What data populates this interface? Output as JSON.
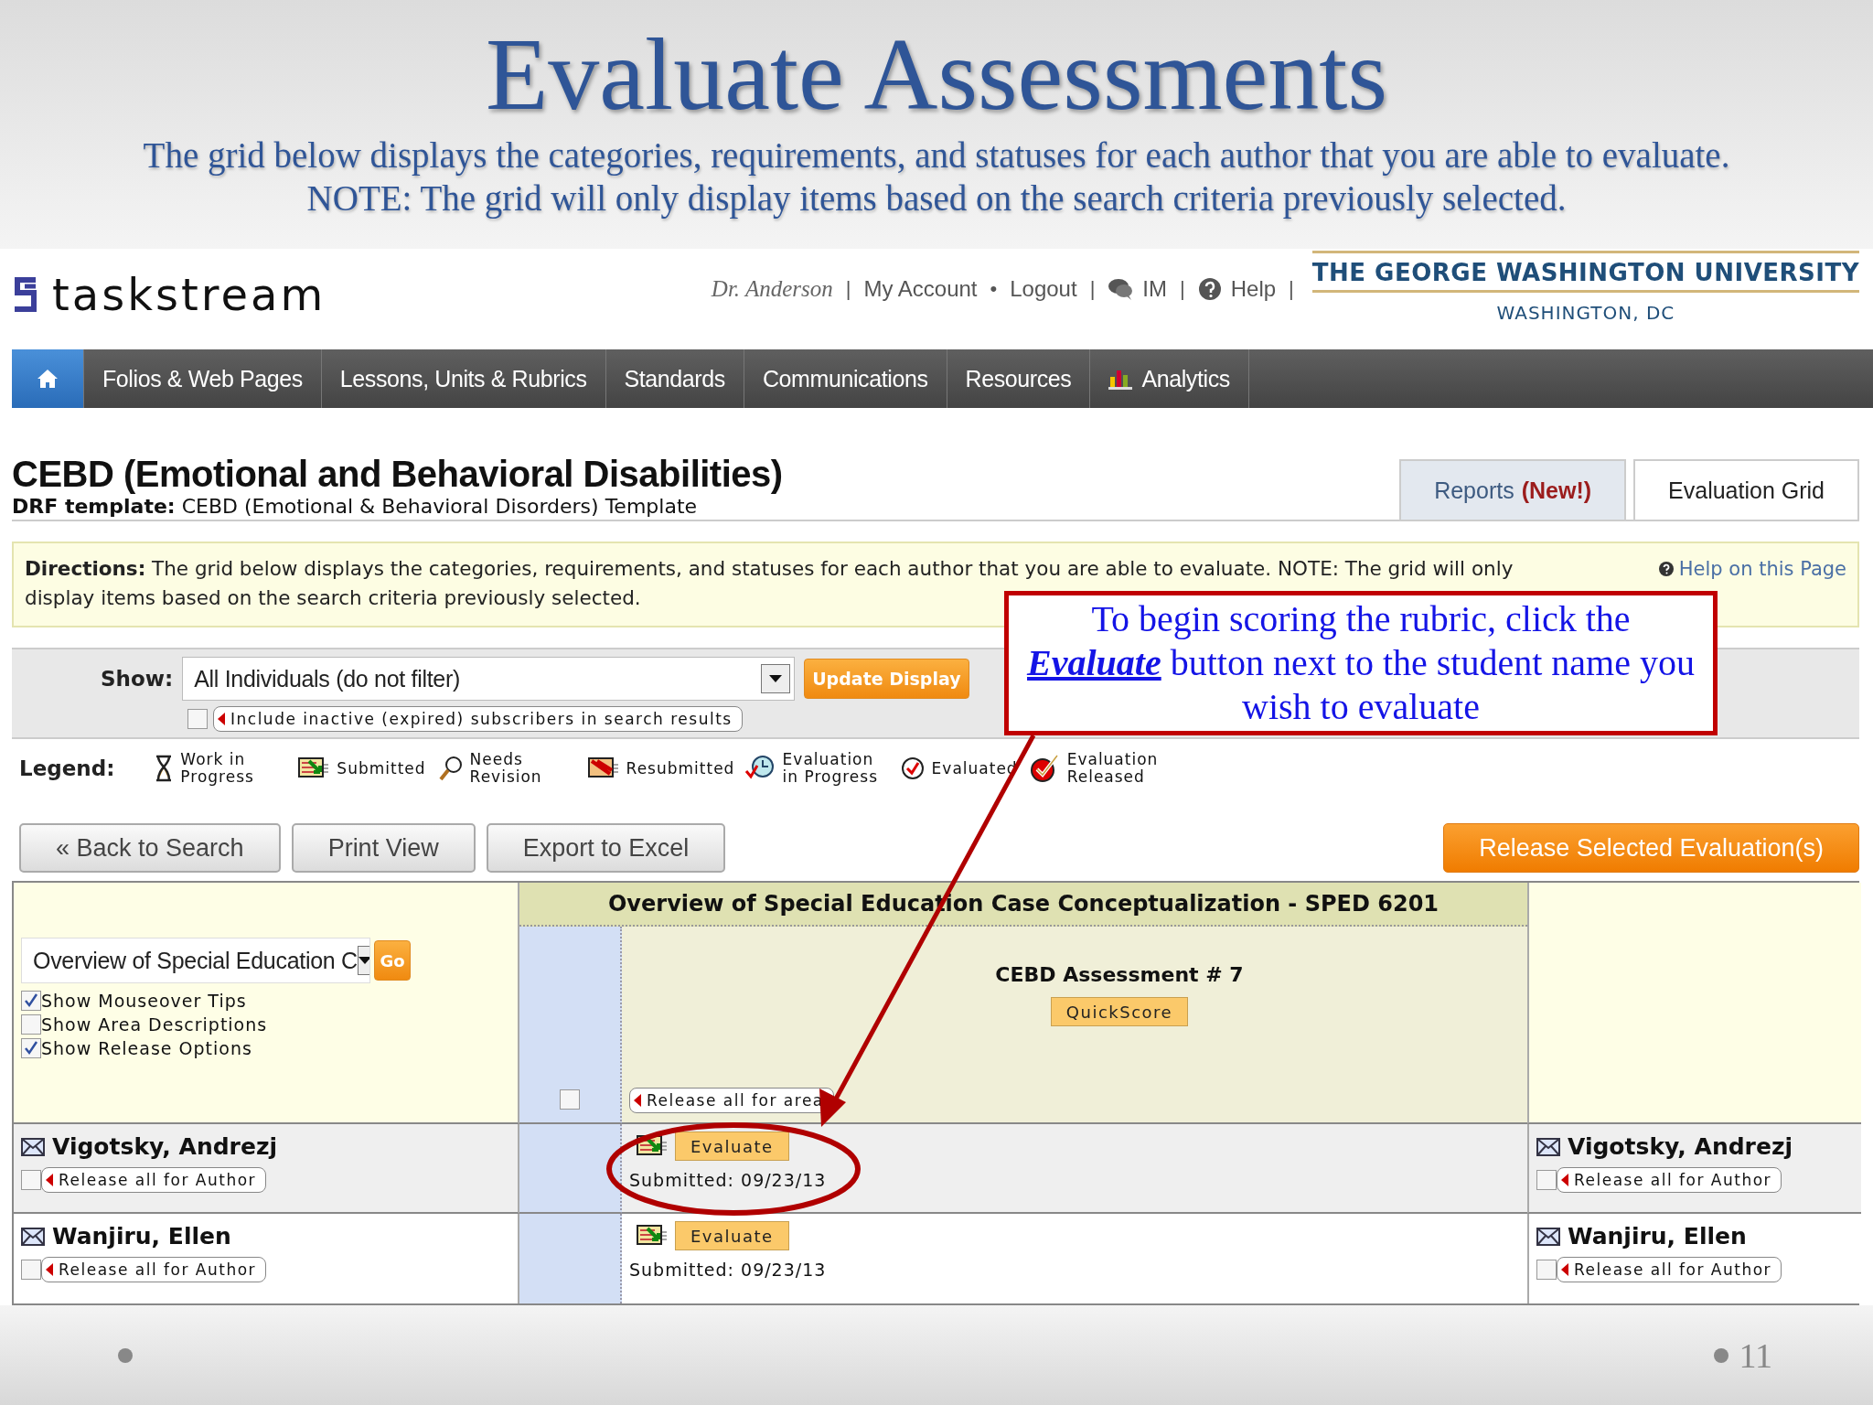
{
  "slide": {
    "title": "Evaluate Assessments",
    "subtitle": "The grid below displays the categories, requirements, and statuses for each author that you are able to evaluate. NOTE: The grid will only display items based on the search criteria previously selected.",
    "page_number": "11"
  },
  "header": {
    "logo": "taskstream",
    "user_links": [
      {
        "kind": "user",
        "label": "Dr. Anderson"
      },
      {
        "kind": "sep",
        "label": "|"
      },
      {
        "kind": "link",
        "label": "My Account"
      },
      {
        "kind": "sep",
        "label": "•"
      },
      {
        "kind": "link",
        "label": "Logout"
      },
      {
        "kind": "sep",
        "label": "|"
      },
      {
        "kind": "chat",
        "label": "IM"
      },
      {
        "kind": "sep",
        "label": "|"
      },
      {
        "kind": "help",
        "label": "Help"
      },
      {
        "kind": "sep",
        "label": "|"
      }
    ],
    "institution": "THE GEORGE WASHINGTON UNIVERSITY",
    "location": "WASHINGTON, DC"
  },
  "nav": [
    {
      "kind": "home",
      "selected": true
    },
    {
      "kind": "text",
      "label": "Folios & Web Pages",
      "selected": false
    },
    {
      "kind": "text",
      "label": "Lessons, Units & Rubrics",
      "selected": false
    },
    {
      "kind": "text",
      "label": "Standards",
      "selected": false
    },
    {
      "kind": "text",
      "label": "Communications",
      "selected": false
    },
    {
      "kind": "text",
      "label": "Resources",
      "selected": false
    },
    {
      "kind": "chart",
      "label": "Analytics",
      "selected": false
    }
  ],
  "page": {
    "title": "CEBD (Emotional and Behavioral Disabilities)",
    "template_label": "DRF template:",
    "template": "CEBD (Emotional & Behavioral Disorders) Template"
  },
  "tabs": [
    {
      "label": "Reports",
      "badge": "(New!)",
      "selected": false
    },
    {
      "label": "Evaluation Grid",
      "selected": true
    }
  ],
  "directions": {
    "text": "**Directions:** The grid below displays the categories, requirements, and statuses for each author that you are able to evaluate. NOTE: The grid will only display items based on the search criteria previously selected.",
    "help": "Help on this Page"
  },
  "filter": {
    "label": "Show:",
    "value": "All Individuals (do not filter)",
    "button": "Update Display",
    "inactive": {
      "label": "Include inactive (expired) subscribers in search results",
      "checked": false
    }
  },
  "legend": {
    "label": "Legend:",
    "items": [
      "Work in Progress",
      "Submitted",
      "Needs Revision",
      "Resubmitted",
      "Evaluation in Progress",
      "Evaluated",
      "Evaluation Released"
    ]
  },
  "actions": {
    "left": [
      "« Back to Search",
      "Print View",
      "Export to Excel"
    ],
    "right": "Release Selected Evaluation(s)"
  },
  "grid": {
    "area_select": "Overview of Special Education C",
    "go": "Go",
    "options": [
      {
        "label": "Show Mouseover Tips",
        "checked": true
      },
      {
        "label": "Show Area Descriptions",
        "checked": false
      },
      {
        "label": "Show Release Options",
        "checked": true
      }
    ],
    "area_title": "Overview of Special Education Case Conceptualization - SPED 6201",
    "area_checked": false,
    "requirement": "CEBD Assessment # 7",
    "quickscore": "QuickScore",
    "release_area": "Release all for area",
    "rows": [
      {
        "name": "Vigotsky, Andrezj",
        "release": "Release all for Author",
        "checked": false,
        "evaluate": "Evaluate",
        "status": "Submitted: 09/23/13",
        "right_name": "Vigotsky, Andrezj",
        "right_release": "Release all for Author",
        "right_checked": false
      },
      {
        "name": "Wanjiru, Ellen",
        "release": "Release all for Author",
        "checked": false,
        "evaluate": "Evaluate",
        "status": "Submitted: 09/23/13",
        "right_name": "Wanjiru, Ellen",
        "right_release": "Release all for Author",
        "right_checked": false
      }
    ]
  },
  "callout": {
    "lead": "To begin scoring the rubric, click the",
    "emphasis": "Evaluate",
    "rest": "button next to the student name you wish to evaluate"
  }
}
